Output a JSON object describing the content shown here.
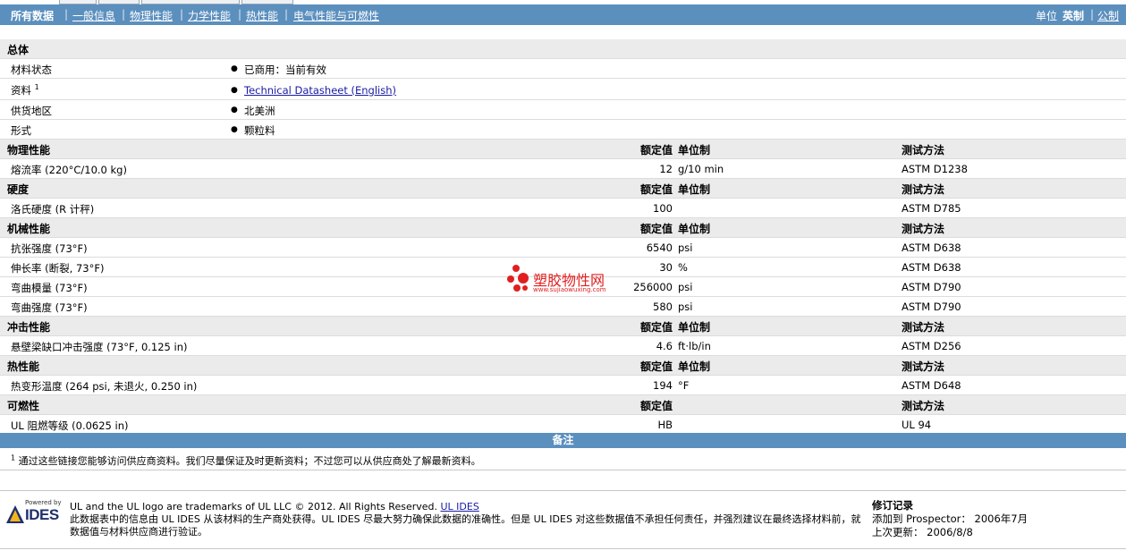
{
  "nav": {
    "items": [
      {
        "label": "所有数据",
        "active": true
      },
      {
        "label": "一般信息"
      },
      {
        "label": "物理性能"
      },
      {
        "label": "力学性能"
      },
      {
        "label": "热性能"
      },
      {
        "label": "电气性能与可燃性"
      }
    ],
    "units_label": "单位",
    "unit_english": "英制",
    "unit_metric": "公制"
  },
  "general": {
    "title": "总体",
    "rows": [
      {
        "name": "材料状态",
        "value": "已商用：当前有效"
      },
      {
        "name": "资料",
        "footnote": "1",
        "value": "Technical Datasheet (English)"
      },
      {
        "name": "供货地区",
        "value": "北美洲"
      },
      {
        "name": "形式",
        "value": "颗粒料"
      }
    ]
  },
  "col_headers": {
    "nominal": "额定值",
    "unit": "单位制",
    "method": "测试方法"
  },
  "sections": [
    {
      "title": "物理性能",
      "rows": [
        {
          "name": "熔流率 (220°C/10.0 kg)",
          "value": "12",
          "unit": "g/10 min",
          "method": "ASTM D1238"
        }
      ]
    },
    {
      "title": "硬度",
      "rows": [
        {
          "name": "洛氏硬度 (R 计秤)",
          "value": "100",
          "unit": "",
          "method": "ASTM D785"
        }
      ]
    },
    {
      "title": "机械性能",
      "rows": [
        {
          "name": "抗张强度 (73°F)",
          "value": "6540",
          "unit": "psi",
          "method": "ASTM D638"
        },
        {
          "name": "伸长率 (断裂, 73°F)",
          "value": "30",
          "unit": "%",
          "method": "ASTM D638"
        },
        {
          "name": "弯曲模量 (73°F)",
          "value": "256000",
          "unit": "psi",
          "method": "ASTM D790"
        },
        {
          "name": "弯曲强度 (73°F)",
          "value": "580",
          "unit": "psi",
          "method": "ASTM D790"
        }
      ]
    },
    {
      "title": "冲击性能",
      "rows": [
        {
          "name": "悬壁梁缺口冲击强度 (73°F, 0.125 in)",
          "value": "4.6",
          "unit": "ft·lb/in",
          "method": "ASTM D256"
        }
      ]
    },
    {
      "title": "热性能",
      "rows": [
        {
          "name": "热变形温度 (264 psi, 未退火, 0.250 in)",
          "value": "194",
          "unit": "°F",
          "method": "ASTM D648"
        }
      ]
    },
    {
      "title": "可燃性",
      "no_unit_header": true,
      "rows": [
        {
          "name": "UL 阻燃等级 (0.0625 in)",
          "value": "HB",
          "unit": "",
          "method": "UL 94"
        }
      ]
    }
  ],
  "remarks": {
    "title": "备注",
    "note_mark": "1",
    "note": "通过这些链接您能够访问供应商资料。我们尽量保证及时更新资料；不过您可以从供应商处了解最新资料。"
  },
  "footer": {
    "powered_by": "Powered by",
    "logo_text": "IDES",
    "trademark": "UL and the UL logo are trademarks of UL LLC © 2012. All Rights Reserved.",
    "trademark_link": "UL IDES",
    "disclaimer": "此数据表中的信息由 UL IDES 从该材料的生产商处获得。UL IDES 尽最大努力确保此数据的准确性。但是 UL IDES 对这些数据值不承担任何责任，并强烈建议在最终选择材料前，就数据值与材料供应商进行验证。",
    "revision_title": "修订记录",
    "added_label": "添加到 Prospector：",
    "added_value": "2006年7月",
    "updated_label": "上次更新：",
    "updated_value": "2006/8/8"
  },
  "watermark": {
    "title": "塑胶物性网",
    "url": "www.sujiaowuxing.com"
  },
  "colors": {
    "nav_bg": "#5b8fbe",
    "section_bg": "#ebebeb",
    "link": "#1a1aa6",
    "watermark": "#e02020"
  }
}
